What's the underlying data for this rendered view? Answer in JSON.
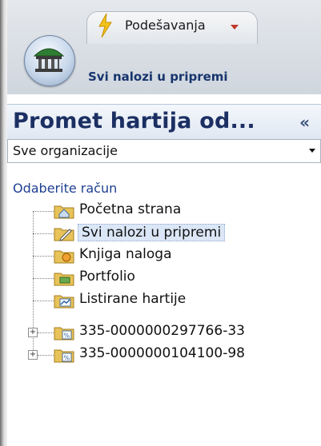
{
  "ribbon": {
    "tab_label": "Podešavanja",
    "document_title": "Svi nalozi u pripremi"
  },
  "panel": {
    "title": "Promet hartija od...",
    "collapse_symbol": "«",
    "organization": {
      "selected": "Sve organizacije"
    },
    "account_label": "Odaberite račun",
    "tree": [
      {
        "label": "Početna strana",
        "icon": "home-folder-icon"
      },
      {
        "label": "Svi nalozi u pripremi",
        "icon": "edit-folder-icon",
        "selected": true
      },
      {
        "label": "Knjiga naloga",
        "icon": "book-icon"
      },
      {
        "label": "Portfolio",
        "icon": "portfolio-folder-icon"
      },
      {
        "label": "Listirane hartije",
        "icon": "chart-folder-icon"
      },
      {
        "label": "335-0000000297766-33",
        "icon": "percent-folder-icon",
        "expandable": true
      },
      {
        "label": "335-0000000104100-98",
        "icon": "percent-folder-icon",
        "expandable": true
      }
    ]
  },
  "colors": {
    "title_blue": "#1b2f63",
    "link_blue": "#1e3f91",
    "selection": "#dbe6f7",
    "folder": "#e8c35a"
  }
}
